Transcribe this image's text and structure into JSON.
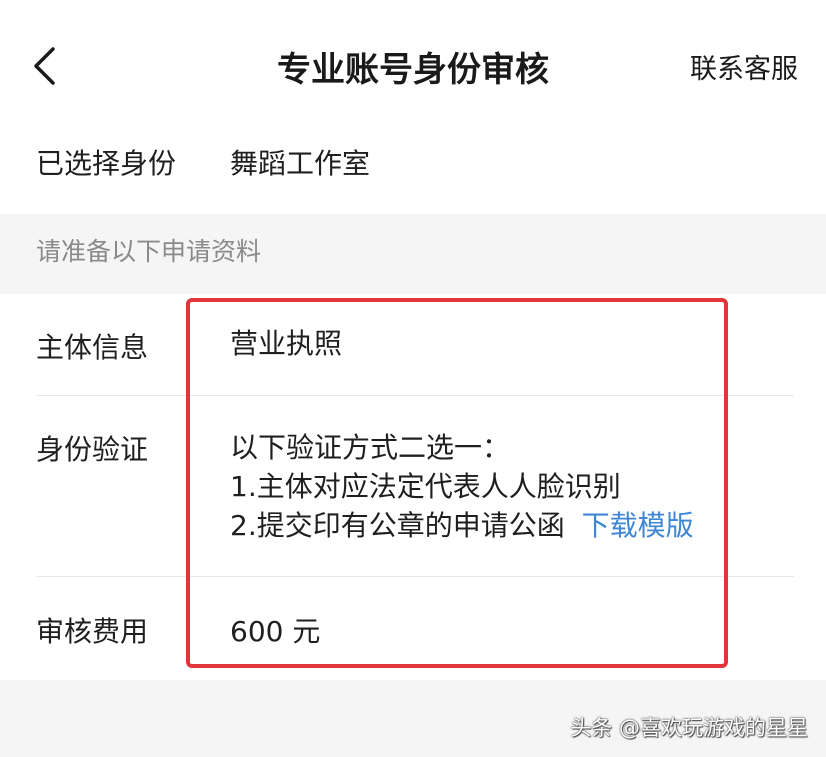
{
  "header": {
    "title": "专业账号身份审核",
    "contact_label": "联系客服",
    "back_icon": "chevron-left-icon"
  },
  "identity": {
    "label": "已选择身份",
    "value": "舞蹈工作室"
  },
  "section_header": "请准备以下申请资料",
  "rows": {
    "subject": {
      "label": "主体信息",
      "value": "营业执照"
    },
    "verification": {
      "label": "身份验证",
      "line1": "以下验证方式二选一：",
      "line2": "1.主体对应法定代表人人脸识别",
      "line3": "2.提交印有公章的申请公函",
      "download_link": "下载模版"
    },
    "fee": {
      "label": "审核费用",
      "value": "600 元"
    }
  },
  "watermark": "头条 @喜欢玩游戏的星星",
  "colors": {
    "link": "#3f86d4",
    "highlight": "#e2353a",
    "section_bg": "#f5f5f5"
  }
}
